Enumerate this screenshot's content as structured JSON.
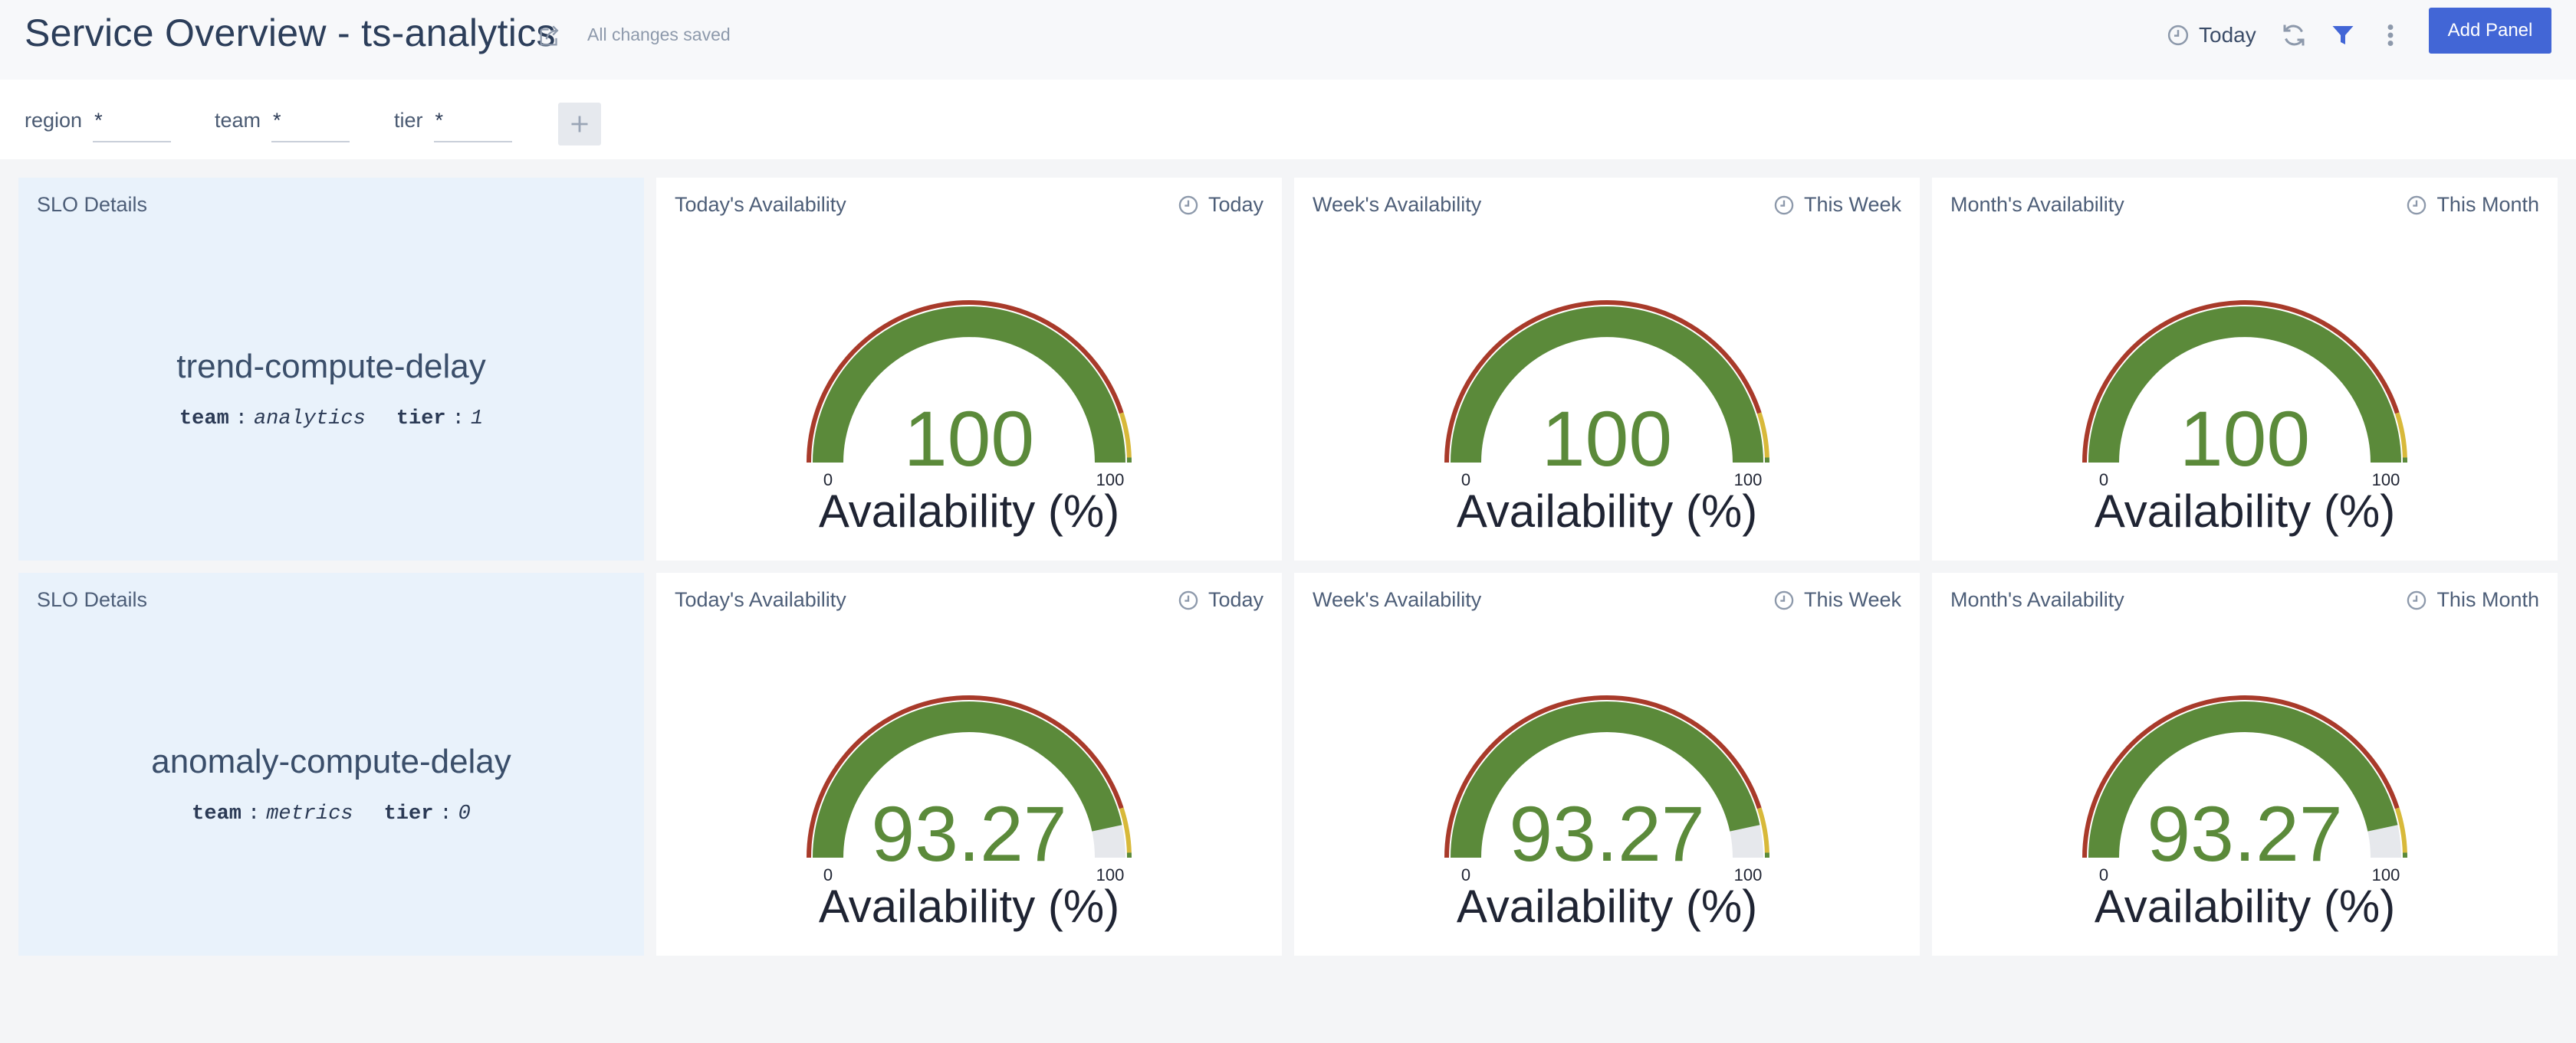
{
  "header": {
    "title": "Service Overview - ts-analytics",
    "save_status": "All changes saved",
    "time_range": "Today",
    "add_panel_label": "Add Panel",
    "accent_color": "#4266d6"
  },
  "filters": [
    {
      "name": "region",
      "value": "*"
    },
    {
      "name": "team",
      "value": "*"
    },
    {
      "name": "tier",
      "value": "*"
    }
  ],
  "rows": [
    {
      "slo": {
        "panel_title": "SLO Details",
        "name": "trend-compute-delay",
        "team_key": "team",
        "team_value": "analytics",
        "tier_key": "tier",
        "tier_value": "1"
      },
      "gauges": [
        {
          "title": "Today's Availability",
          "time": "Today",
          "value": "100",
          "min": "0",
          "max": "100",
          "label": "Availability (%)"
        },
        {
          "title": "Week's Availability",
          "time": "This Week",
          "value": "100",
          "min": "0",
          "max": "100",
          "label": "Availability (%)"
        },
        {
          "title": "Month's Availability",
          "time": "This Month",
          "value": "100",
          "min": "0",
          "max": "100",
          "label": "Availability (%)"
        }
      ]
    },
    {
      "slo": {
        "panel_title": "SLO Details",
        "name": "anomaly-compute-delay",
        "team_key": "team",
        "team_value": "metrics",
        "tier_key": "tier",
        "tier_value": "0"
      },
      "gauges": [
        {
          "title": "Today's Availability",
          "time": "Today",
          "value": "93.27",
          "min": "0",
          "max": "100",
          "label": "Availability (%)"
        },
        {
          "title": "Week's Availability",
          "time": "This Week",
          "value": "93.27",
          "min": "0",
          "max": "100",
          "label": "Availability (%)"
        },
        {
          "title": "Month's Availability",
          "time": "This Month",
          "value": "93.27",
          "min": "0",
          "max": "100",
          "label": "Availability (%)"
        }
      ]
    }
  ],
  "gauge_colors": {
    "fill": "#5b8a3a",
    "track": "#e6e8ec",
    "band_red": "#a83a2a",
    "band_yellow": "#d8b93a",
    "band_green": "#5b8a3a",
    "value_text": "#5b8a3a",
    "label_text": "#1f2433"
  }
}
